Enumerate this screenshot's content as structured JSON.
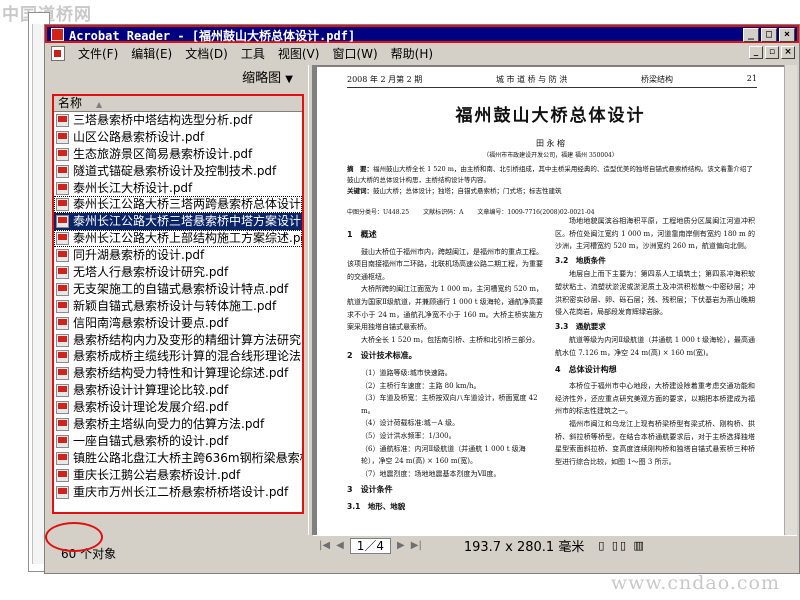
{
  "watermark_top": "中国道桥网",
  "watermark_bottom": "www.cndao.com",
  "window": {
    "title": "Acrobat Reader - [福州鼓山大桥总体设计.pdf]"
  },
  "menubar": {
    "items": [
      "文件(F)",
      "编辑(E)",
      "文档(D)",
      "工具",
      "视图(V)",
      "窗口(W)",
      "帮助(H)"
    ]
  },
  "leftpane": {
    "thumbnail_label": "缩略图",
    "column_header": "名称",
    "files": [
      "三塔悬索桥中塔结构选型分析.pdf",
      "山区公路悬索桥设计.pdf",
      "生态旅游景区简易悬索桥设计.pdf",
      "隧道式锚碇悬索桥设计及控制技术.pdf",
      "泰州长江大桥设计.pdf",
      "泰州长江公路大桥三塔两跨悬索桥总体设计.pdf",
      "泰州长江公路大桥三塔悬索桥中塔方案设计.pdf",
      "泰州长江公路大桥上部结构施工方案综述.pdf",
      "同升湖悬索桥的设计.pdf",
      "无塔人行悬索桥设计研究.pdf",
      "无支架施工的自锚式悬索桥设计特点.pdf",
      "新颖自锚式悬索桥设计与转体施工.pdf",
      "信阳南湾悬索桥设计要点.pdf",
      "悬索桥结构内力及变形的精细计算方法研究.pdf",
      "悬索桥成桥主缆线形计算的混合线形理论法.pdf",
      "悬索桥结构受力特性和计算理论综述.pdf",
      "悬索桥设计计算理论比较.pdf",
      "悬索桥设计理论发展介绍.pdf",
      "悬索桥主塔纵向受力的估算方法.pdf",
      "一座自锚式悬索桥的设计.pdf",
      "镇胜公路北盘江大桥主跨636m钢桁梁悬索桥.pdf",
      "重庆长江鹅公岩悬索桥设计.pdf",
      "重庆市万州长江二桥悬索桥桥塔设计.pdf"
    ],
    "status": "60 个对象"
  },
  "document": {
    "running_head_left": "2008 年 2 月第 2 期",
    "running_head_center": "城 市 道 桥 与 防 洪",
    "running_head_right": "桥梁结构",
    "page_number": "21",
    "title": "福州鼓山大桥总体设计",
    "author": "田 永 榕",
    "affiliation": "（福州市市政建设开发公司，福建 福州 350004）",
    "abstract_label": "摘　要：",
    "abstract": "福州鼓山大桥全长 1 520 m，由主桥和南、北引桥组成，其中主桥采用经典的、造型优美的独塔自锚式悬索桥结构。该文着重介绍了鼓山大桥的总体设计构思，主桥结构设计等内容。",
    "keywords_label": "关键词：",
    "keywords": "鼓山大桥；总体设计；独塔；自锚式悬索桥；门式塔；标志性建筑",
    "meta": [
      "中图分类号：U448.25",
      "文献标识码：A",
      "文章编号：1009-7716(2008)02-0021-04"
    ],
    "left_column": {
      "s1_title": "1　概述",
      "s1_p1": "鼓山大桥位于福州市内，跨越闽江，是福州市的重点工程。该项目南接福州市二环路，北联机场高速公路二期工程，为重要的交通枢纽。",
      "s1_p2": "大桥所跨的闽江江面宽为 1 000 m，主河槽宽约 520 m，航道为国家Ⅱ级航道，并兼顾通行 1 000 t 级海轮，通航净高要求不小于 24 m，通航孔净宽不小于 160 m。大桥主桥实施方案采用独塔自锚式悬索桥。",
      "s1_p3": "大桥全长 1 520 m，包括南引桥、主桥和北引桥三部分。",
      "s2_title": "2　设计技术标准。",
      "s2_items": [
        "（1）道路等级:城市快速路。",
        "（2）主桥行车速度：主路 80 km/h。",
        "（3）车道及桥宽：主桥按双向八车道设计，桥面宽度 42 m。",
        "（4）设计荷载标准:城－A 级。",
        "（5）设计洪水频率：1/300。",
        "（6）通航标准：内河Ⅱ级航道（并通航 1 000 t 级海轮），净空 24 m(高) × 160 m(宽)。",
        "（7）地震烈度：场地地震基本烈度为Ⅶ度。"
      ],
      "s3_title": "3　设计条件",
      "s3_sub": "3.1　地形、地貌"
    },
    "right_column": {
      "p1": "场地地貌属滨谷相海积平原，工程地质分区属闽江河道冲积区。桥位处闽江宽约 1 000 m，河道靠南岸侧有宽约 180 m 的沙洲，主河槽宽约 520 m，沙洲宽约 260 m，航道偏向北侧。",
      "s32_title": "3.2　地质条件",
      "s32_p": "地层自上而下主要为：第四系人工填筑土；第四系冲海积软塑状粘土、流塑状淤泥或淤泥质土及冲洪积松散～中密砂层；冲洪积密实砂层、卵、砾石层；残、残积层；下伏基岩为燕山晚期侵入花岗岩，局部段发育辉绿岩脉。",
      "s33_title": "3.3　通航要求",
      "s33_p": "航道等级为内河Ⅱ级航道（并通航 1 000 t 级海轮），最高通航水位 7.126 m，净空 24 m(高) × 160 m(宽)。",
      "s4_title": "4　总体设计构想",
      "s4_p1": "本桥位于福州市中心地段，大桥建设除着重考虑交通功能和经济性外，还应重点研究美观方面的要求，以期把本桥建成为福州市的标志性建筑之一。",
      "s4_p2": "福州市闽江和乌龙江上现有桥梁桥型有梁式桥、刚构桥、拱桥、斜拉桥等桥型，在结合本桥通航要求后，对于主桥选择独塔星型索面斜拉桥、变高度连续刚构桥和独塔自锚式悬索桥三种桥型进行综合比较，如图 1～图 3 所示。"
    }
  },
  "navbar": {
    "page_indicator": "1／4",
    "page_size": "193.7 x 280.1 毫米"
  },
  "colors": {
    "title_bar": "#000080",
    "annotation_red": "#e01010",
    "selection": "#0a246a"
  }
}
